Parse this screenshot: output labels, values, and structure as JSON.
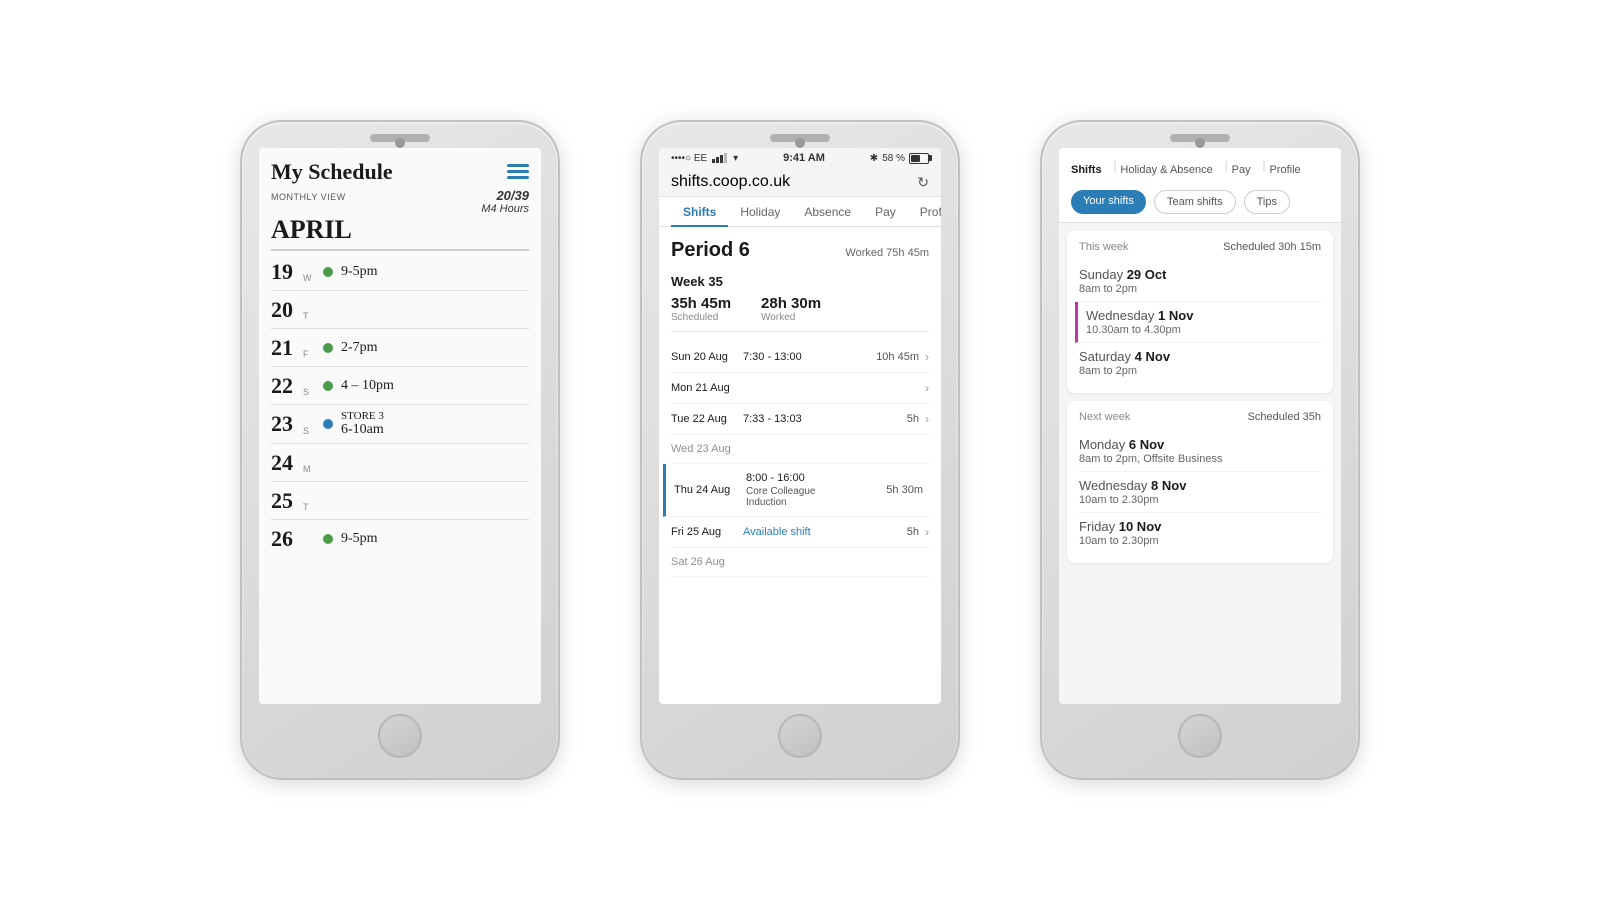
{
  "phones": {
    "phone1": {
      "title": "My Schedule",
      "meta": "Monthly View",
      "hours_fraction": "20/39",
      "hours_label": "M4 Hours",
      "month": "APRIL",
      "rows": [
        {
          "day_num": "19",
          "day_letter": "W",
          "has_dot": true,
          "dot_color": "green",
          "time": "9-5pm"
        },
        {
          "day_num": "20",
          "day_letter": "T",
          "has_dot": false,
          "dot_color": "",
          "time": ""
        },
        {
          "day_num": "21",
          "day_letter": "F",
          "has_dot": true,
          "dot_color": "green",
          "time": "2-7pm"
        },
        {
          "day_num": "22",
          "day_letter": "S",
          "has_dot": true,
          "dot_color": "green",
          "time": "4 - 10pm"
        },
        {
          "day_num": "23",
          "day_letter": "S",
          "has_dot": true,
          "dot_color": "blue",
          "time_line1": "STORE 3",
          "time_line2": "6-10am"
        },
        {
          "day_num": "24",
          "day_letter": "M",
          "has_dot": false,
          "dot_color": "",
          "time": ""
        },
        {
          "day_num": "25",
          "day_letter": "T",
          "has_dot": false,
          "dot_color": "",
          "time": ""
        },
        {
          "day_num": "26",
          "day_letter": "",
          "has_dot": true,
          "dot_color": "green",
          "time": "9-5pm"
        }
      ]
    },
    "phone2": {
      "statusbar": {
        "carrier": "••••○ EE",
        "wifi": "▾",
        "time": "9:41 AM",
        "bluetooth": "✱",
        "battery_pct": "58 %"
      },
      "url": "shifts.coop.co.uk",
      "tabs": [
        "Shifts",
        "Holiday",
        "Absence",
        "Pay",
        "Profile"
      ],
      "active_tab": "Shifts",
      "period_title": "Period 6",
      "period_worked": "Worked 75h 45m",
      "week_label": "Week 35",
      "week_scheduled_val": "35h 45m",
      "week_scheduled_label": "Scheduled",
      "week_worked_val": "28h 30m",
      "week_worked_label": "Worked",
      "shift_rows": [
        {
          "day": "Sun 20 Aug",
          "time": "7:30 - 13:00",
          "duration": "10h 45m",
          "has_chevron": true,
          "highlighted": false,
          "dimmed": false,
          "available": false
        },
        {
          "day": "Mon 21 Aug",
          "time": "",
          "duration": "",
          "has_chevron": true,
          "highlighted": false,
          "dimmed": false,
          "available": false
        },
        {
          "day": "Tue 22 Aug",
          "time": "7:33 - 13:03",
          "duration": "5h",
          "has_chevron": true,
          "highlighted": false,
          "dimmed": false,
          "available": false
        },
        {
          "day": "Wed 23 Aug",
          "time": "",
          "duration": "",
          "has_chevron": false,
          "highlighted": false,
          "dimmed": true,
          "available": false
        },
        {
          "day": "Thu 24 Aug",
          "time": "8:00 - 16:00",
          "duration": "5h 30m",
          "has_chevron": false,
          "highlighted": true,
          "dimmed": false,
          "available": false,
          "detail": "Core Colleague\nInduction"
        },
        {
          "day": "Fri 25 Aug",
          "time": "Available shift",
          "duration": "5h",
          "has_chevron": true,
          "highlighted": false,
          "dimmed": false,
          "available": true
        },
        {
          "day": "Sat 26 Aug",
          "time": "",
          "duration": "",
          "has_chevron": false,
          "highlighted": false,
          "dimmed": true,
          "available": false
        }
      ]
    },
    "phone3": {
      "nav_tabs": [
        "Shifts",
        "Holiday & Absence",
        "Pay",
        "Profile"
      ],
      "active_nav_tab": "Shifts",
      "sub_tabs": [
        "Your shifts",
        "Team shifts",
        "Tips"
      ],
      "active_sub_tab": "Your shifts",
      "this_week_label": "This week",
      "this_week_scheduled": "Scheduled 30h 15m",
      "this_week_shifts": [
        {
          "day_name": "Sunday",
          "day_date": "29 Oct",
          "time": "8am to 2pm",
          "accent": false
        },
        {
          "day_name": "Wednesday",
          "day_date": "1 Nov",
          "time": "10.30am to 4.30pm",
          "accent": true
        },
        {
          "day_name": "Saturday",
          "day_date": "4 Nov",
          "time": "8am to 2pm",
          "accent": false
        }
      ],
      "next_week_label": "Next week",
      "next_week_scheduled": "Scheduled 35h",
      "next_week_shifts": [
        {
          "day_name": "Monday",
          "day_date": "6 Nov",
          "time": "8am to 2pm, Offsite Business",
          "accent": false
        },
        {
          "day_name": "Wednesday",
          "day_date": "8 Nov",
          "time": "10am to 2.30pm",
          "accent": false
        },
        {
          "day_name": "Friday",
          "day_date": "10 Nov",
          "time": "10am to 2.30pm",
          "accent": false
        }
      ]
    }
  }
}
